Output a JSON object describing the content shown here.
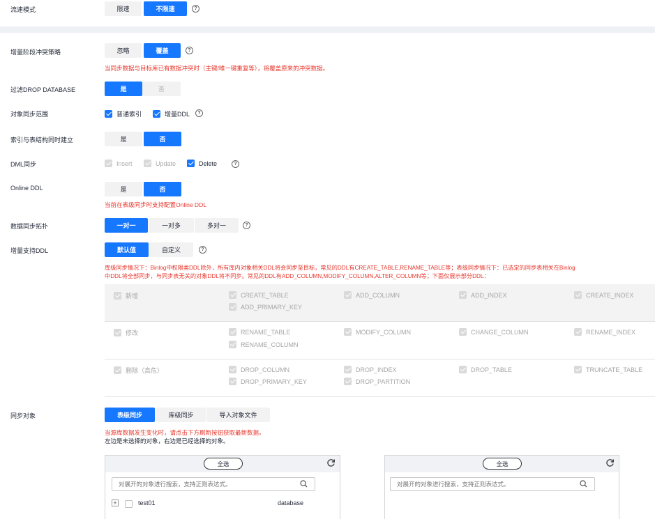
{
  "flow_mode": {
    "label": "流速模式",
    "options": [
      "限速",
      "不限速"
    ]
  },
  "conflict": {
    "label": "增量阶段冲突策略",
    "options": [
      "忽略",
      "覆盖"
    ],
    "note": "当同步数据与目标库已有数据冲突时（主键/唯一键重复等），将覆盖原来的冲突数据。"
  },
  "drop_db": {
    "label": "过滤DROP DATABASE",
    "options": [
      "是",
      "否"
    ]
  },
  "scope": {
    "label": "对象同步范围",
    "items": [
      "普通索引",
      "增量DDL"
    ]
  },
  "index_build": {
    "label": "索引与表结构同时建立",
    "options": [
      "是",
      "否"
    ]
  },
  "dml": {
    "label": "DML同步",
    "items": [
      "Insert",
      "Update",
      "Delete"
    ]
  },
  "online_ddl": {
    "label": "Online DDL",
    "options": [
      "是",
      "否"
    ],
    "note": "当前在表级同步时支持配置Online DDL"
  },
  "topology": {
    "label": "数据同步拓扑",
    "options": [
      "一对一",
      "一对多",
      "多对一"
    ]
  },
  "ddl_support": {
    "label": "增量支持DDL",
    "options": [
      "默认值",
      "自定义"
    ],
    "note1": "库级同步情况下：Binlog中权限类DDL除外，所有库内对象相关DDL将会同步至目标，常见的DDL有CREATE_TABLE,RENAME_TABLE等；表级同步情况下：已选定的同步表相关在Binlog",
    "note2": "中DDL将全部同步，与同步表无关的对象DDL将不同步。常见的DDL有ADD_COLUMN,MODIFY_COLUMN,ALTER_COLUMN等；下面仅展示部分DDL："
  },
  "ddl_rows": [
    {
      "group": "新增",
      "items": [
        "CREATE_TABLE",
        "ADD_PRIMARY_KEY",
        "ADD_COLUMN",
        "ADD_INDEX",
        "CREATE_INDEX"
      ]
    },
    {
      "group": "修改",
      "items": [
        "RENAME_TABLE",
        "RENAME_COLUMN",
        "MODIFY_COLUMN",
        "CHANGE_COLUMN",
        "RENAME_INDEX"
      ]
    },
    {
      "group": "删除（高危）",
      "items": [
        "DROP_COLUMN",
        "DROP_PRIMARY_KEY",
        "DROP_INDEX",
        "DROP_PARTITION",
        "DROP_TABLE",
        "TRUNCATE_TABLE"
      ]
    }
  ],
  "sync_obj": {
    "label": "同步对象",
    "options": [
      "表级同步",
      "库级同步",
      "导入对象文件"
    ],
    "note": "当源库数据发生变化时，请点击下方刷新按钮获取最新数据。",
    "hint": "左边是未选择的对象，右边是已经选择的对象。"
  },
  "left_panel": {
    "all": "全选",
    "placeholder": "对展开的对象进行搜索，支持正则表达式。",
    "tree": [
      {
        "name": "test01",
        "type": "database"
      }
    ]
  },
  "right_panel": {
    "all": "全选",
    "placeholder": "对展开的对象进行搜索，支持正则表达式。"
  }
}
